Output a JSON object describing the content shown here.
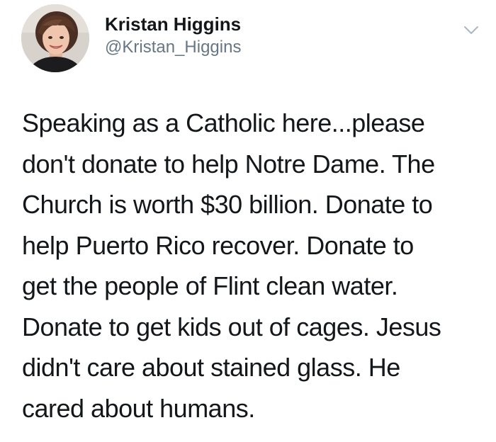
{
  "user": {
    "display_name": "Kristan Higgins",
    "handle": "@Kristan_Higgins",
    "avatar_icon": "profile-photo"
  },
  "menu": {
    "icon": "chevron-down-icon"
  },
  "tweet": {
    "lines": [
      "Speaking as a Catholic here...please",
      "don't donate to help Notre Dame. The",
      "Church is worth $30 billion. Donate to",
      "help Puerto Rico recover. Donate to",
      "get the people of Flint clean water.",
      "Donate to get kids out of cages. Jesus",
      "didn't care about stained glass. He",
      "cared about humans."
    ]
  },
  "colors": {
    "name": "#14171a",
    "handle": "#657786",
    "text": "#14171a",
    "chevron": "#aab8c2",
    "background": "#ffffff"
  }
}
